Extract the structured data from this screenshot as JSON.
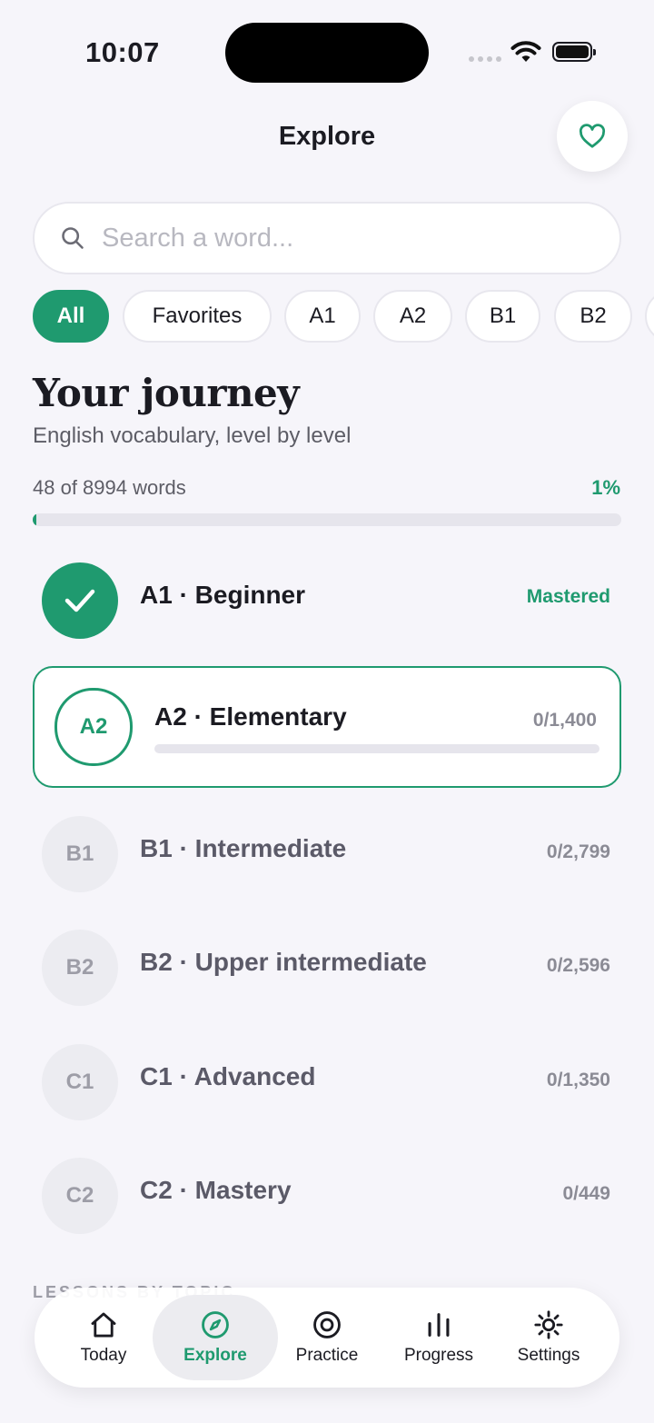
{
  "status": {
    "time": "10:07"
  },
  "header": {
    "title": "Explore"
  },
  "search": {
    "placeholder": "Search a word..."
  },
  "filters": [
    "All",
    "Favorites",
    "A1",
    "A2",
    "B1",
    "B2"
  ],
  "journey": {
    "title": "Your journey",
    "subtitle": "English vocabulary, level by level",
    "count_text": "48 of 8994 words",
    "percent_text": "1%",
    "progress_fraction": 0.005
  },
  "levels": [
    {
      "code": "A1",
      "name": "A1 · Beginner",
      "status": "Mastered"
    },
    {
      "code": "A2",
      "name": "A2 · Elementary",
      "count": "0/1,400"
    },
    {
      "code": "B1",
      "name": "B1 · Intermediate",
      "count": "0/2,799"
    },
    {
      "code": "B2",
      "name": "B2 · Upper intermediate",
      "count": "0/2,596"
    },
    {
      "code": "C1",
      "name": "C1 · Advanced",
      "count": "0/1,350"
    },
    {
      "code": "C2",
      "name": "C2 · Mastery",
      "count": "0/449"
    }
  ],
  "next_section": "LESSONS BY TOPIC",
  "tabs": [
    {
      "label": "Today",
      "icon": "home-icon"
    },
    {
      "label": "Explore",
      "icon": "compass-icon"
    },
    {
      "label": "Practice",
      "icon": "target-icon"
    },
    {
      "label": "Progress",
      "icon": "bar-chart-icon"
    },
    {
      "label": "Settings",
      "icon": "gear-icon"
    }
  ],
  "colors": {
    "accent": "#1f9a6f",
    "background": "#f6f5fa"
  }
}
